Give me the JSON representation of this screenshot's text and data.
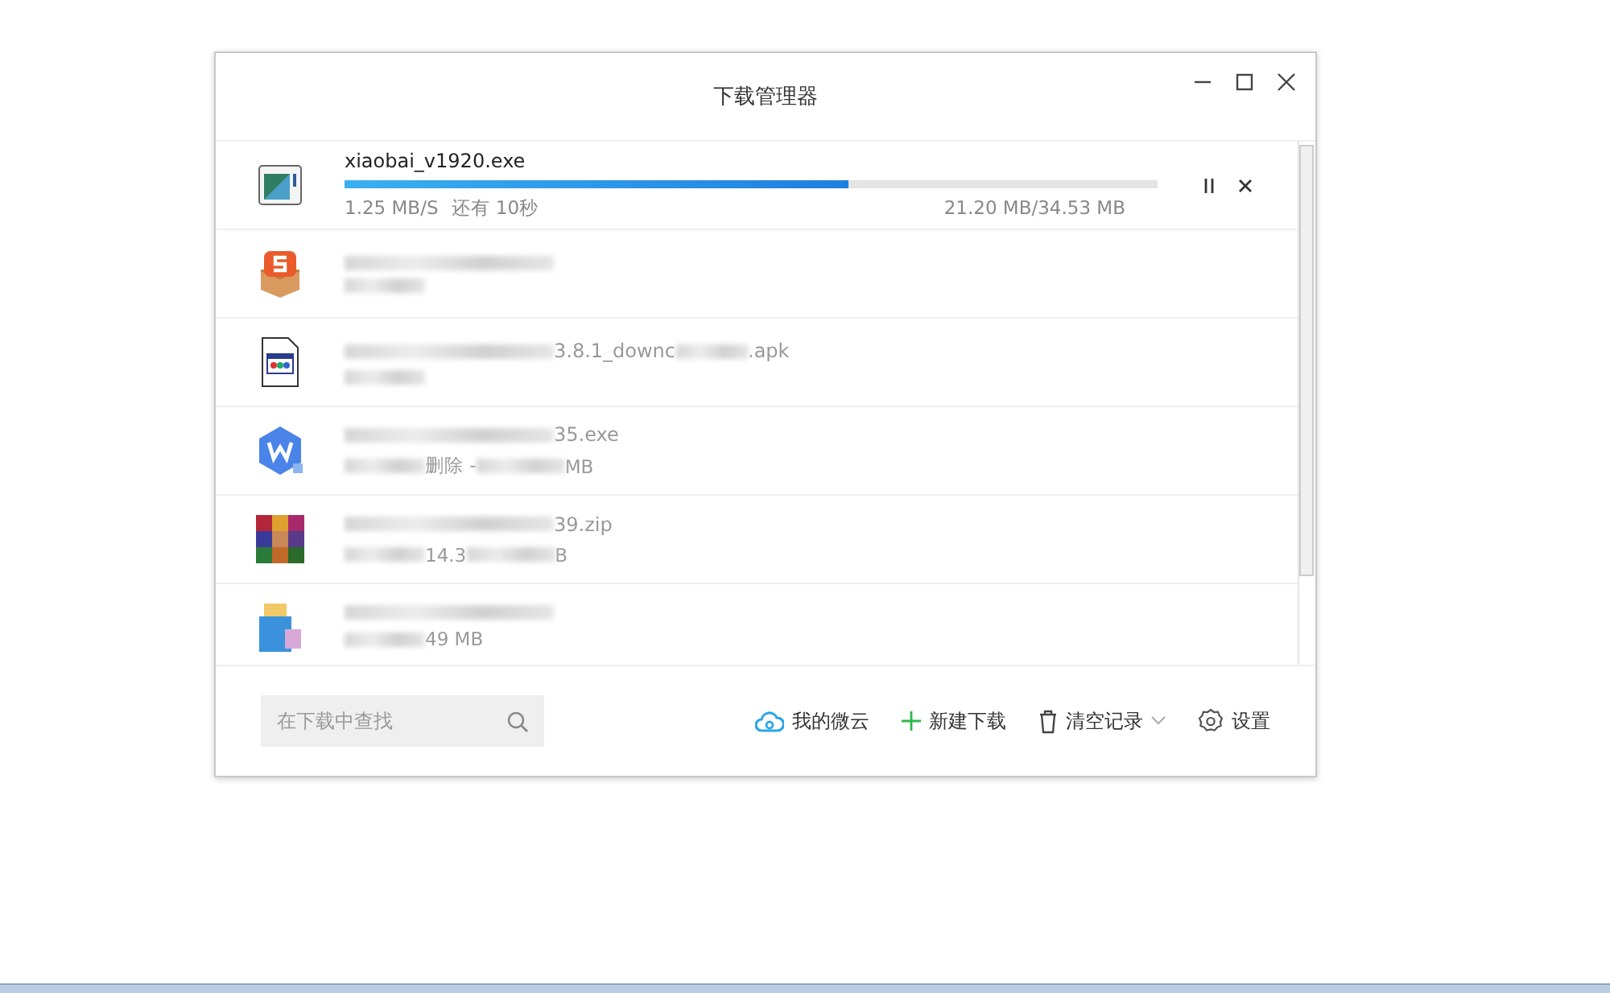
{
  "window": {
    "title": "下载管理器",
    "controls": [
      {
        "kind": "minimize"
      },
      {
        "kind": "maximize"
      },
      {
        "kind": "close"
      }
    ]
  },
  "active_download": {
    "name": "xiaobai_v1920.exe",
    "level": 0.62,
    "speed": "1.25 MB/S",
    "remaining": "还有 10秒",
    "size": "21.20 MB/34.53 MB",
    "actions": [
      {
        "kind": "pause"
      },
      {
        "kind": "cancel"
      }
    ]
  },
  "downloads": [
    {
      "kind": "sogou",
      "name": [
        {
          "kind": "blur"
        }
      ],
      "status": [
        {
          "kind": "blur"
        }
      ]
    },
    {
      "kind": "apk",
      "name": [
        {
          "kind": "blur"
        },
        {
          "kind": "text",
          "text": "3.8.1_downc"
        },
        {
          "kind": "blur"
        },
        {
          "kind": "text",
          "text": ".apk"
        }
      ],
      "status": [
        {
          "kind": "blur"
        }
      ]
    },
    {
      "kind": "wps",
      "name": [
        {
          "kind": "blur"
        },
        {
          "kind": "text",
          "text": "35.exe"
        }
      ],
      "status": [
        {
          "kind": "blur"
        },
        {
          "kind": "text",
          "text": "删除 - "
        },
        {
          "kind": "blur"
        },
        {
          "kind": "text",
          "text": " MB"
        }
      ]
    },
    {
      "kind": "archive",
      "name": [
        {
          "kind": "blur"
        },
        {
          "kind": "text",
          "text": "39.zip"
        }
      ],
      "status": [
        {
          "kind": "blur"
        },
        {
          "kind": "text",
          "text": "14.3"
        },
        {
          "kind": "blur"
        },
        {
          "kind": "text",
          "text": "B"
        }
      ]
    },
    {
      "kind": "installer",
      "name": [
        {
          "kind": "blur"
        }
      ],
      "status": [
        {
          "kind": "blur"
        },
        {
          "kind": "text",
          "text": "49 MB"
        }
      ]
    }
  ],
  "footer": {
    "search": {
      "placeholder": "在下载中查找"
    },
    "actions": [
      {
        "kind": "cloud",
        "label": "我的微云"
      },
      {
        "kind": "new",
        "label": "新建下载"
      },
      {
        "kind": "clear",
        "label": "清空记录"
      },
      {
        "kind": "settings",
        "label": "设置"
      }
    ]
  }
}
